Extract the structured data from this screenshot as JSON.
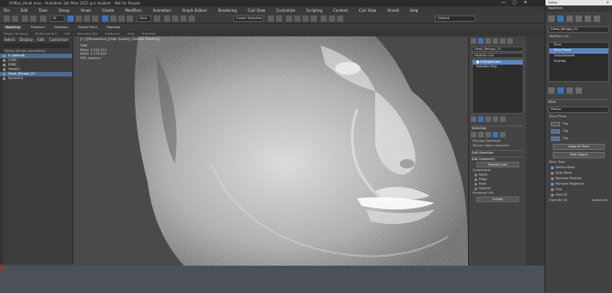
{
  "app": {
    "title": "OrMax_Hindi.max - Autodesk 3ds Max 2021 pro student - Not for Resale",
    "window_buttons": [
      "—",
      "▢",
      "✕"
    ]
  },
  "menu": [
    "File",
    "Edit",
    "Tools",
    "Group",
    "Views",
    "Create",
    "Modifiers",
    "Animation",
    "Graph Editors",
    "Rendering",
    "Civil View",
    "Customize",
    "Scripting",
    "Content",
    "Civil View",
    "Arnold",
    "Help"
  ],
  "toolbar": {
    "selection_dropdown": "Create Selection Se",
    "workspace_dropdown": "Default"
  },
  "ribbon": {
    "tabs": [
      "Modeling",
      "Freeform",
      "Selection",
      "Object Paint",
      "Populate"
    ],
    "active_tab": "Modeling",
    "subtabs": [
      "Polygon Modeling",
      "Modify Selection",
      "Edit",
      "Geometry (All)",
      "Subdivision",
      "Align",
      "Properties"
    ]
  },
  "explorer": {
    "tabs": [
      "Select",
      "Display",
      "Edit",
      "Customize"
    ],
    "header": "Name (Sorted Ascending)",
    "rows": [
      {
        "label": "0 (default)",
        "selected": true
      },
      {
        "label": "LOD0",
        "selected": false
      },
      {
        "label": "EBBC",
        "selected": false
      },
      {
        "label": "Head01",
        "selected": false
      },
      {
        "label": "Head_Retopo_01",
        "selected": true
      },
      {
        "label": "Sphere01",
        "selected": false
      }
    ]
  },
  "viewport": {
    "label": "[+] [Perspective] [High Quality] [Default Shading]",
    "stats": [
      "Total",
      "Polys: 3,543,210",
      "Verts: 1,775,402",
      "FPS: Inactive"
    ]
  },
  "cmdpanel": {
    "object_name": "Head_Retopo_01",
    "modifier_list": "Modifier List",
    "stack": [
      {
        "label": "■ ProOptimizer",
        "selected": true
      },
      {
        "label": "Editable Poly",
        "selected": false
      }
    ],
    "section_selection": "Selection",
    "preserve_label": "Preview Selection",
    "whole_object": "Whole Object Selected",
    "soft_selection": "Soft Selection",
    "edit_geometry": "Edit Geometry",
    "repeat_last": "Repeat Last",
    "constraints": "Constraints",
    "radios": [
      "None",
      "Edge",
      "Face",
      "Normal"
    ],
    "preserve_uvs": "Preserve UVs",
    "create": "Create"
  },
  "modwin": {
    "title": "Editor",
    "menu": "Modifiers",
    "object_name": "Head_Retopo_01",
    "modifier_list": "Modifier List",
    "stack": [
      {
        "label": "Slice",
        "selected": false
      },
      {
        "label": "Slice Plane",
        "selected": true
      },
      {
        "label": "TurboSmooth",
        "selected": false
      },
      {
        "label": "Unwrap",
        "selected": false
      }
    ],
    "section_slice": "Slice",
    "plane_label": "Planar",
    "slice_plane": "Slice Plane",
    "flip_x": "Flip",
    "flip_y": "Flip",
    "flip_z": "Flip",
    "align_button": "Align to Face",
    "pick_button": "Pick Object",
    "slice_type": "Slice Type",
    "options": [
      {
        "label": "Refine Mesh",
        "on": true
      },
      {
        "label": "Split Mesh",
        "on": false
      },
      {
        "label": "Remove Positive",
        "on": false
      },
      {
        "label": "Remove Negative",
        "on": true
      }
    ],
    "cap": "Cap",
    "face_id": "Face ID",
    "operate_on_label": "Operate On:",
    "operate_on_value": "Automatic"
  }
}
